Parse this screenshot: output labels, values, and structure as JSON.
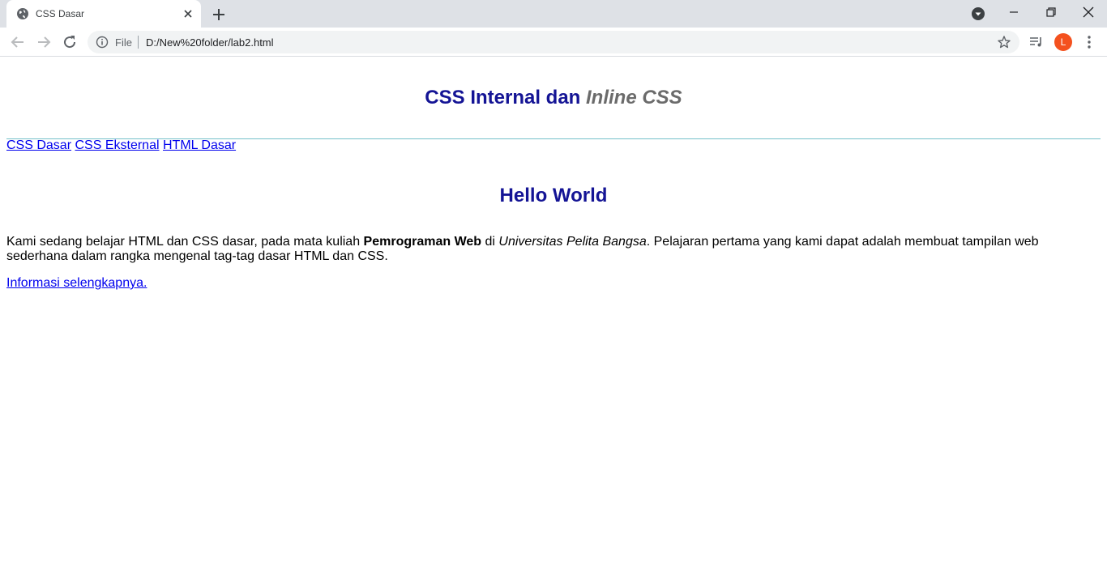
{
  "browser": {
    "tab": {
      "title": "CSS Dasar",
      "favicon": "globe-icon"
    },
    "address": {
      "scheme_label": "File",
      "url": "D:/New%20folder/lab2.html"
    },
    "profile_initial": "L",
    "colors": {
      "tabstrip": "#dee1e6",
      "avatar": "#f4511e"
    }
  },
  "page": {
    "heading": {
      "part1": "CSS Internal dan ",
      "part2": "Inline CSS"
    },
    "nav_links": [
      "CSS Dasar",
      "CSS Eksternal",
      "HTML Dasar"
    ],
    "subheading": "Hello World",
    "paragraph": {
      "text1": "Kami sedang belajar HTML dan CSS dasar, pada mata kuliah ",
      "bold": "Pemrograman Web",
      "text2": " di ",
      "italic": "Universitas Pelita Bangsa",
      "text3": ". Pelajaran pertama yang kami dapat adalah membuat tampilan web sederhana dalam rangka mengenal tag-tag dasar HTML dan CSS."
    },
    "more_link": "Informasi selengkapnya.",
    "colors": {
      "heading": "#141495",
      "heading_italic": "#6b6b6b",
      "link": "#0000ee",
      "rule": "#74c1c9"
    }
  }
}
